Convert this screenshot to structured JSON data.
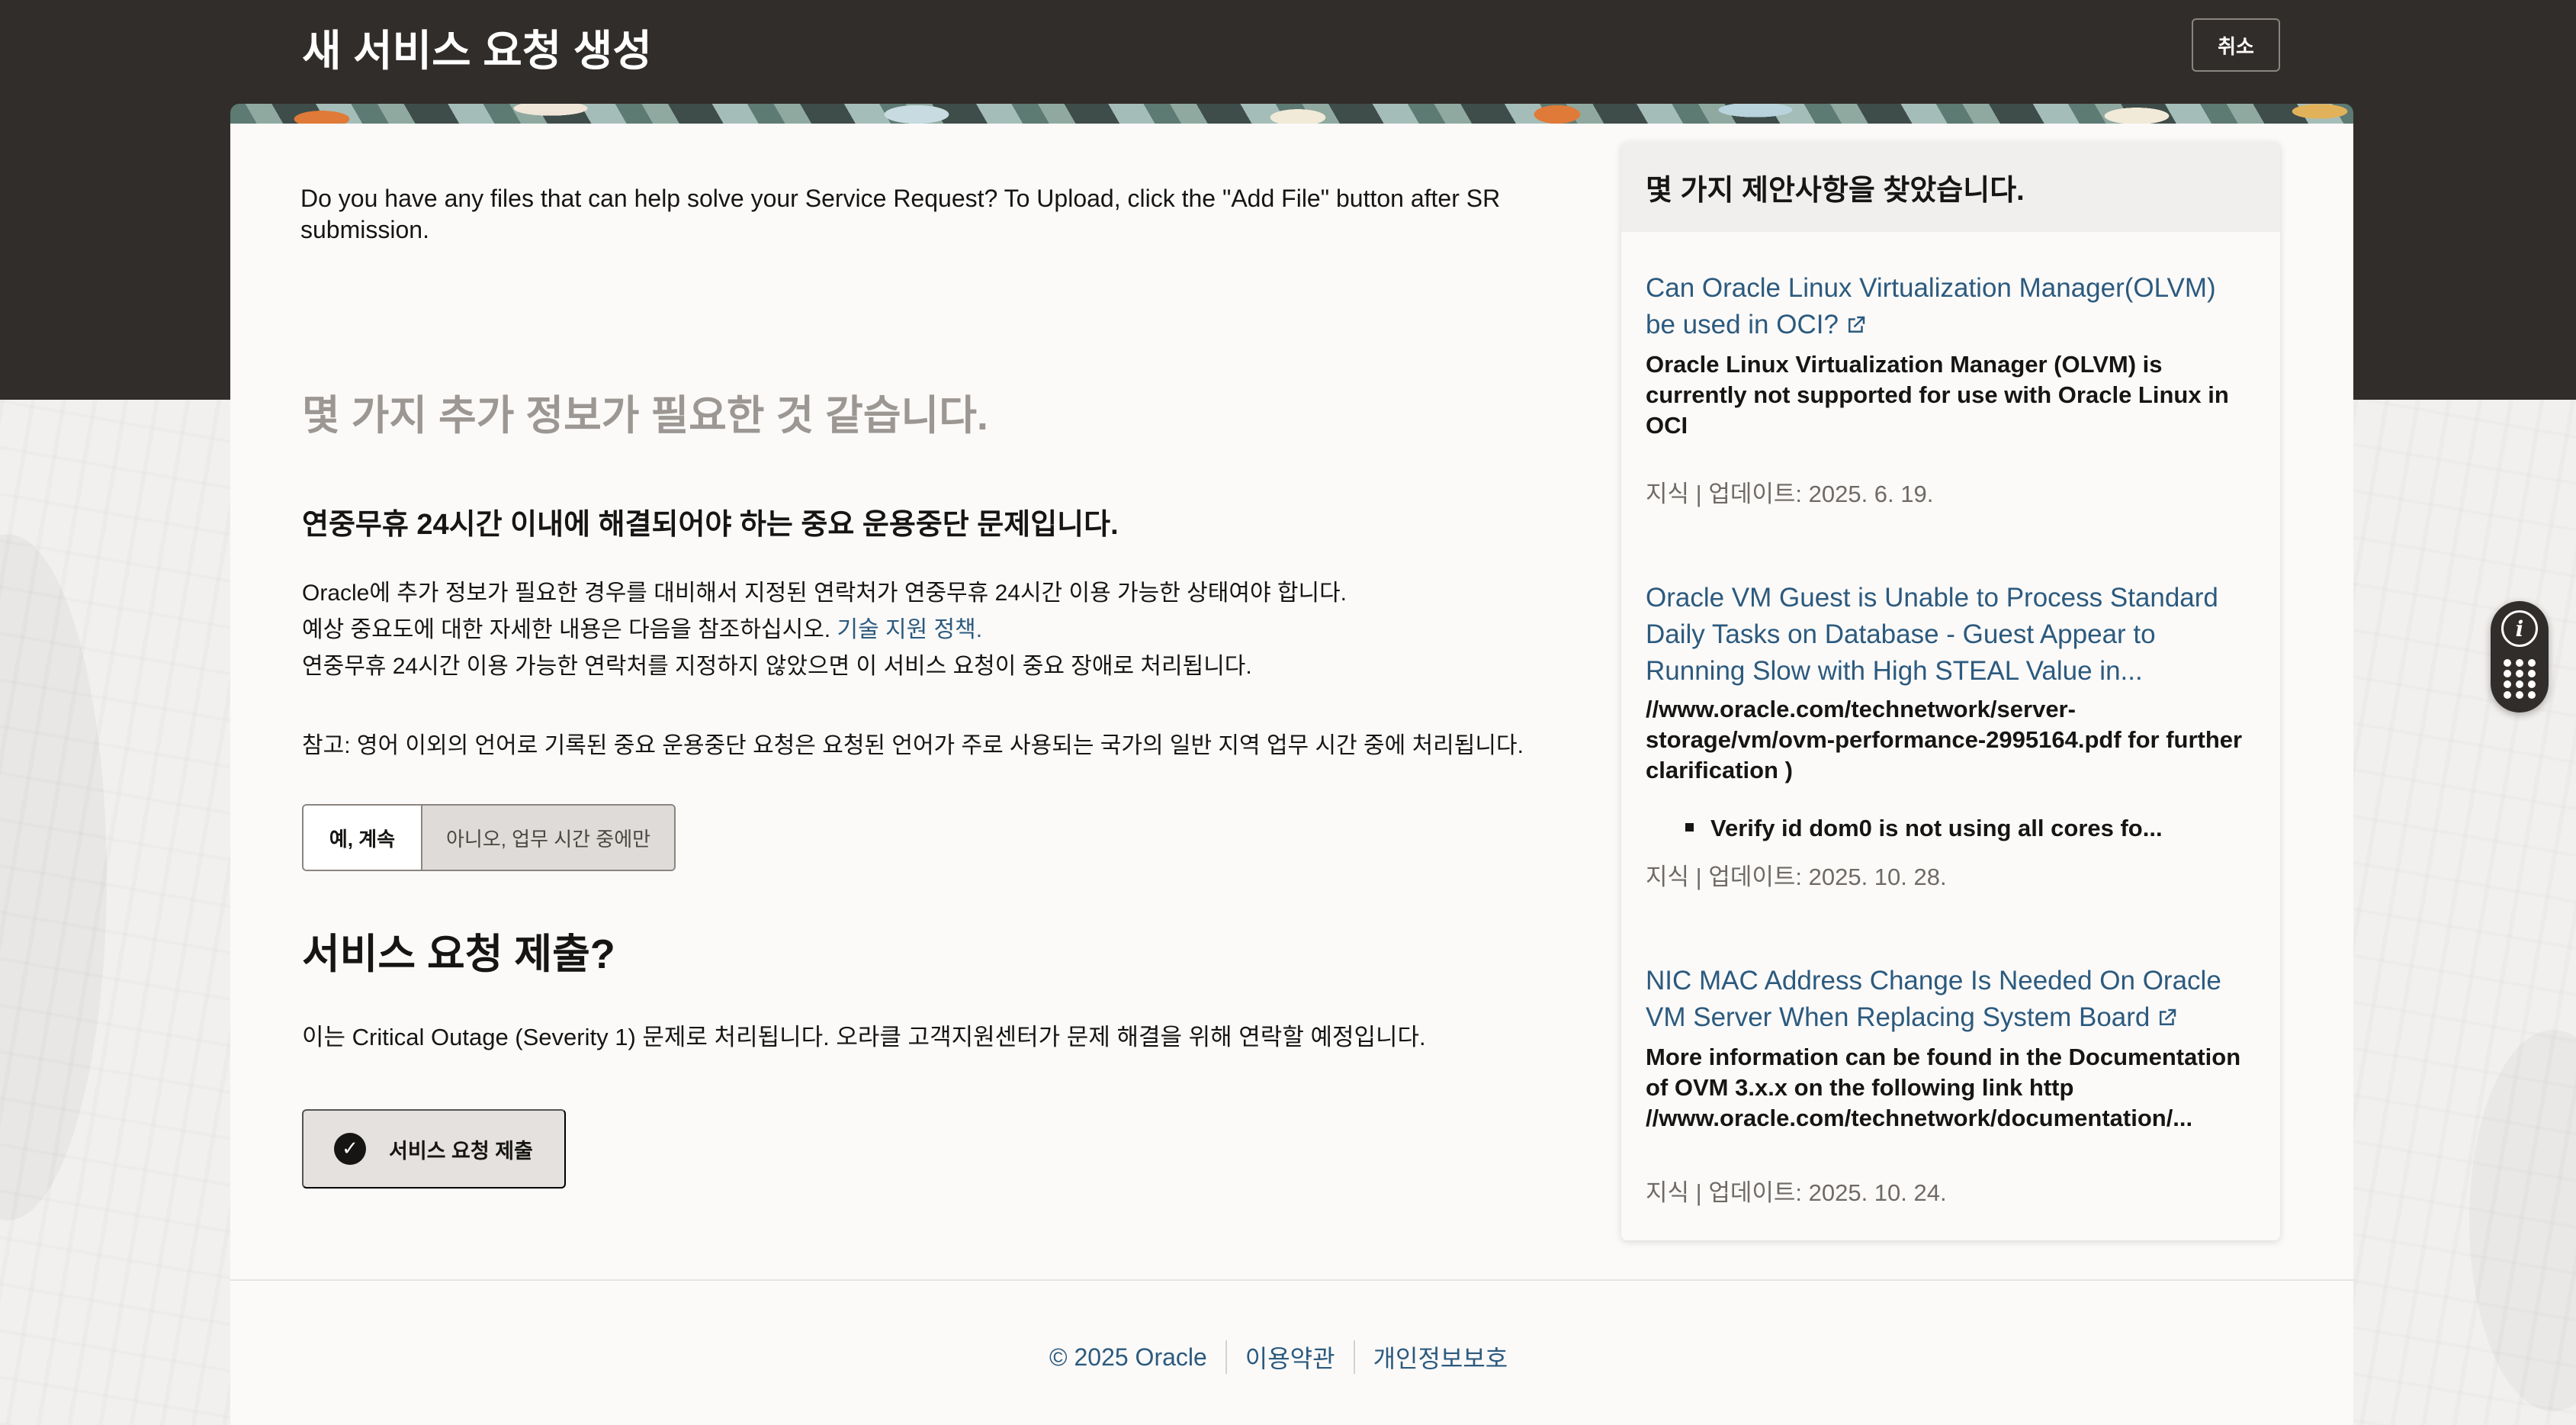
{
  "header": {
    "title": "새 서비스 요청 생성",
    "cancel_label": "취소"
  },
  "main": {
    "upload_text": "Do you have any files that can help solve your Service Request? To Upload, click the \"Add File\" button after SR submission.",
    "need_info_heading": "몇 가지 추가 정보가 필요한 것 같습니다.",
    "outage_heading": "연중무휴 24시간 이내에 해결되어야 하는 중요 운용중단 문제입니다.",
    "para1": "Oracle에 추가 정보가 필요한 경우를 대비해서 지정된 연락처가 연중무휴 24시간 이용 가능한 상태여야 합니다.",
    "para2_prefix": "예상 중요도에 대한 자세한 내용은 다음을 참조하십시오. ",
    "para2_link": "기술 지원 정책.",
    "para3": "연중무휴 24시간 이용 가능한 연락처를 지정하지 않았으면 이 서비스 요청이 중요 장애로 처리됩니다.",
    "note": "참고: 영어 이외의 언어로 기록된 중요 운용중단 요청은 요청된 언어가 주로 사용되는 국가의 일반 지역 업무 시간 중에 처리됩니다.",
    "choice_yes": "예, 계속",
    "choice_no": "아니오, 업무 시간 중에만",
    "submit_question": "서비스 요청 제출?",
    "submit_desc": "이는 Critical Outage (Severity 1) 문제로 처리됩니다. 오라클 고객지원센터가 문제 해결을 위해 연락할 예정입니다.",
    "submit_label": "서비스 요청 제출"
  },
  "suggestions": {
    "title": "몇 가지 제안사항을 찾았습니다.",
    "items": [
      {
        "title": "Can Oracle Linux Virtualization Manager(OLVM) be used in OCI?",
        "body": "Oracle Linux Virtualization Manager (OLVM) is currently not supported for use with Oracle Linux in OCI",
        "meta": "지식 | 업데이트: 2025. 6. 19."
      },
      {
        "title": "Oracle VM Guest is Unable to Process Standard Daily Tasks on Database - Guest Appear to Running Slow with High STEAL Value in...",
        "body": "//www.oracle.com/technetwork/server-storage/vm/ovm-performance-2995164.pdf for further clarification )",
        "bullet": "Verify id dom0 is not using all cores fo...",
        "meta": "지식 | 업데이트: 2025. 10. 28."
      },
      {
        "title": "NIC MAC Address Change Is Needed On Oracle VM Server When Replacing System Board",
        "body": "More information can be found in the Documentation of OVM 3.x.x on the following link http //www.oracle.com/technetwork/documentation/...",
        "meta": "지식 | 업데이트: 2025. 10. 24."
      }
    ]
  },
  "widget": {
    "info_glyph": "i"
  },
  "footer": {
    "copyright": "© 2025 Oracle",
    "terms": "이용약관",
    "privacy": "개인정보보호"
  }
}
